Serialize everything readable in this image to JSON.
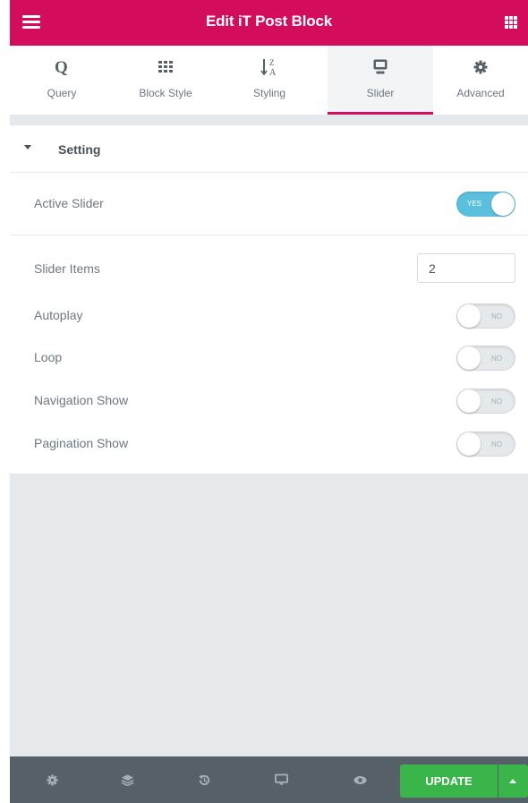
{
  "header": {
    "title": "Edit iT Post Block",
    "menu_icon": "hamburger-icon",
    "apps_icon": "grid-icon",
    "color": "#d30c5c"
  },
  "tabs": [
    {
      "label": "Query",
      "icon": "query-icon",
      "active": false
    },
    {
      "label": "Block Style",
      "icon": "grid-icon",
      "active": false
    },
    {
      "label": "Styling",
      "icon": "sort-az-icon",
      "active": false
    },
    {
      "label": "Slider",
      "icon": "slider-icon",
      "active": true
    },
    {
      "label": "Advanced",
      "icon": "gear-icon",
      "active": false
    }
  ],
  "section": {
    "title": "Setting"
  },
  "controls": {
    "active_slider": {
      "label": "Active Slider",
      "state": "YES",
      "on": true
    },
    "slider_items": {
      "label": "Slider Items",
      "value": "2"
    },
    "autoplay": {
      "label": "Autoplay",
      "state": "NO",
      "on": false
    },
    "loop": {
      "label": "Loop",
      "state": "NO",
      "on": false
    },
    "navigation_show": {
      "label": "Navigation Show",
      "state": "NO",
      "on": false
    },
    "pagination_show": {
      "label": "Pagination Show",
      "state": "NO",
      "on": false
    }
  },
  "footer": {
    "icons": [
      "gear-icon",
      "layers-icon",
      "history-icon",
      "monitor-icon",
      "eye-icon"
    ],
    "update_label": "UPDATE",
    "update_color": "#39b54a"
  }
}
